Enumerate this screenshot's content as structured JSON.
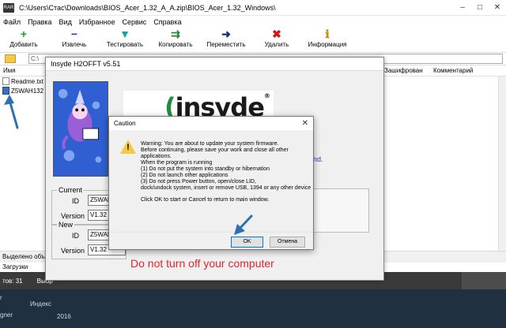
{
  "window": {
    "title": "C:\\Users\\Стас\\Downloads\\BIOS_Acer_1.32_A_A.zip\\BIOS_Acer_1.32_Windows\\",
    "controls": {
      "minimize": "–",
      "maximize": "□",
      "close": "✕"
    }
  },
  "menu": [
    "Файл",
    "Правка",
    "Вид",
    "Избранное",
    "Сервис",
    "Справка"
  ],
  "toolbar": [
    {
      "label": "Добавить",
      "icon": "add-icon",
      "glyph": "+",
      "color": "#1aa33a"
    },
    {
      "label": "Извлечь",
      "icon": "extract-icon",
      "glyph": "−",
      "color": "#1f3fa8"
    },
    {
      "label": "Тестировать",
      "icon": "test-icon",
      "glyph": "▼",
      "color": "#1aa0a8"
    },
    {
      "label": "Копировать",
      "icon": "copy-icon",
      "glyph": "⇉",
      "color": "#1a8a2a"
    },
    {
      "label": "Переместить",
      "icon": "move-icon",
      "glyph": "➜",
      "color": "#1a2a8a"
    },
    {
      "label": "Удалить",
      "icon": "delete-icon",
      "glyph": "✖",
      "color": "#d01818"
    },
    {
      "label": "Информация",
      "icon": "info-icon",
      "glyph": "ℹ",
      "color": "#c0901a"
    }
  ],
  "address": {
    "value": "C:\\"
  },
  "columns": {
    "name": "Имя",
    "encrypted": "Зашифрован",
    "comment": "Комментарий"
  },
  "files": [
    {
      "name": "Readme.txt"
    },
    {
      "name": "Z5WAH132"
    }
  ],
  "status": {
    "left": "Выделено объ"
  },
  "downloads": {
    "label": "Загрузки"
  },
  "explorer": {
    "items": "тов: 31",
    "selected": "Выбр"
  },
  "desktop": {
    "t1": "r",
    "t2": "Индекс",
    "t3": "2016",
    "t4": "gner"
  },
  "h2offt": {
    "title": "Insyde H2OFFT v5.51",
    "logo": "insyde",
    "side_text": "nd.",
    "current": {
      "title": "Current",
      "id_label": "ID",
      "id_value": "Z5WAH",
      "version_label": "Version",
      "version_value": "V1.32"
    },
    "new": {
      "title": "New",
      "id_label": "ID",
      "id_value": "Z5WAH",
      "version_label": "Version",
      "version_value": "V1.32"
    },
    "warning": "Do not turn off your computer"
  },
  "caution": {
    "title": "Caution",
    "close": "✕",
    "icon": "warning-icon",
    "message": "Warning: You are about to update your system firmware.\nBefore continuing, please save your work and close all other applications.\nWhen the program is running\n    (1) Do not put the system into standby or hibernation\n    (2) Do not launch other applications\n    (3) Do not press Power button, open/close LID,\ndock/undock system, insert or remove USB, 1394 or any other device",
    "instruction": "Click OK to start or Cancel to return to main window.",
    "ok": "OK",
    "cancel": "Отмена"
  },
  "colors": {
    "accent": "#0078d7",
    "warning_text": "#e0262e",
    "arrow": "#2f6fb3"
  }
}
